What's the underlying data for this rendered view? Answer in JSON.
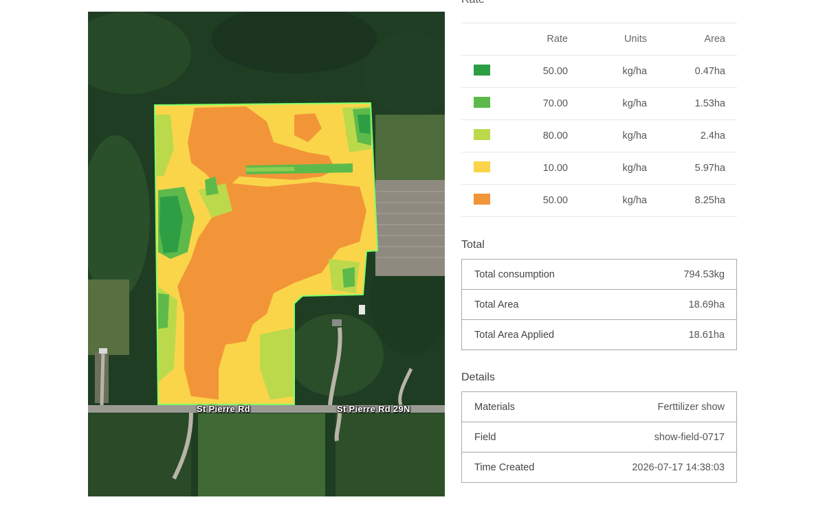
{
  "map": {
    "road_labels": [
      "St Pierre Rd",
      "St Pierre Rd 29N"
    ],
    "colors": {
      "forest": "#1f3d22",
      "field_outline": "#7dff6b",
      "road": "#9a9a93"
    }
  },
  "rate_section": {
    "heading": "Rate",
    "columns": {
      "rate": "Rate",
      "units": "Units",
      "area": "Area"
    },
    "rows": [
      {
        "color": "#2e9e45",
        "rate": "50.00",
        "units": "kg/ha",
        "area": "0.47ha"
      },
      {
        "color": "#5dba4a",
        "rate": "70.00",
        "units": "kg/ha",
        "area": "1.53ha"
      },
      {
        "color": "#bcd94c",
        "rate": "80.00",
        "units": "kg/ha",
        "area": "2.4ha"
      },
      {
        "color": "#fad54a",
        "rate": "10.00",
        "units": "kg/ha",
        "area": "5.97ha"
      },
      {
        "color": "#f29538",
        "rate": "50.00",
        "units": "kg/ha",
        "area": "8.25ha"
      }
    ]
  },
  "total": {
    "title": "Total",
    "rows": [
      {
        "label": "Total consumption",
        "value": "794.53kg"
      },
      {
        "label": "Total Area",
        "value": "18.69ha"
      },
      {
        "label": "Total Area Applied",
        "value": "18.61ha"
      }
    ]
  },
  "details": {
    "title": "Details",
    "rows": [
      {
        "label": "Materials",
        "value": "Ferttilizer show"
      },
      {
        "label": "Field",
        "value": "show-field-0717"
      },
      {
        "label": "Time Created",
        "value": "2026-07-17 14:38:03"
      }
    ]
  }
}
